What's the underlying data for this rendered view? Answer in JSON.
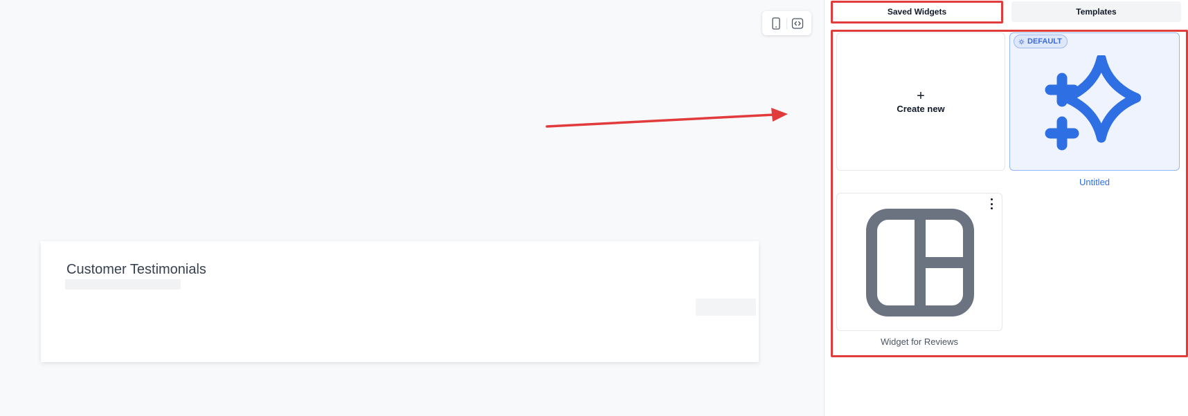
{
  "preview": {
    "section_title": "Customer Testimonials",
    "toolbar": {
      "mobile_icon": "mobile-phone-icon",
      "embed_icon": "code-embed-icon"
    }
  },
  "panel": {
    "tabs": [
      {
        "label": "Saved Widgets",
        "active": true
      },
      {
        "label": "Templates",
        "active": false
      }
    ],
    "create_new": {
      "icon": "+",
      "label": "Create new"
    },
    "widgets": [
      {
        "name": "Untitled",
        "badge": "DEFAULT",
        "icon": "sparkles-icon",
        "color": "#2f6fe4"
      },
      {
        "name": "Widget for Reviews",
        "icon": "layout-grid-icon",
        "color": "#6b7280"
      }
    ]
  },
  "annotations": {
    "highlight_color": "#e23b3b"
  }
}
